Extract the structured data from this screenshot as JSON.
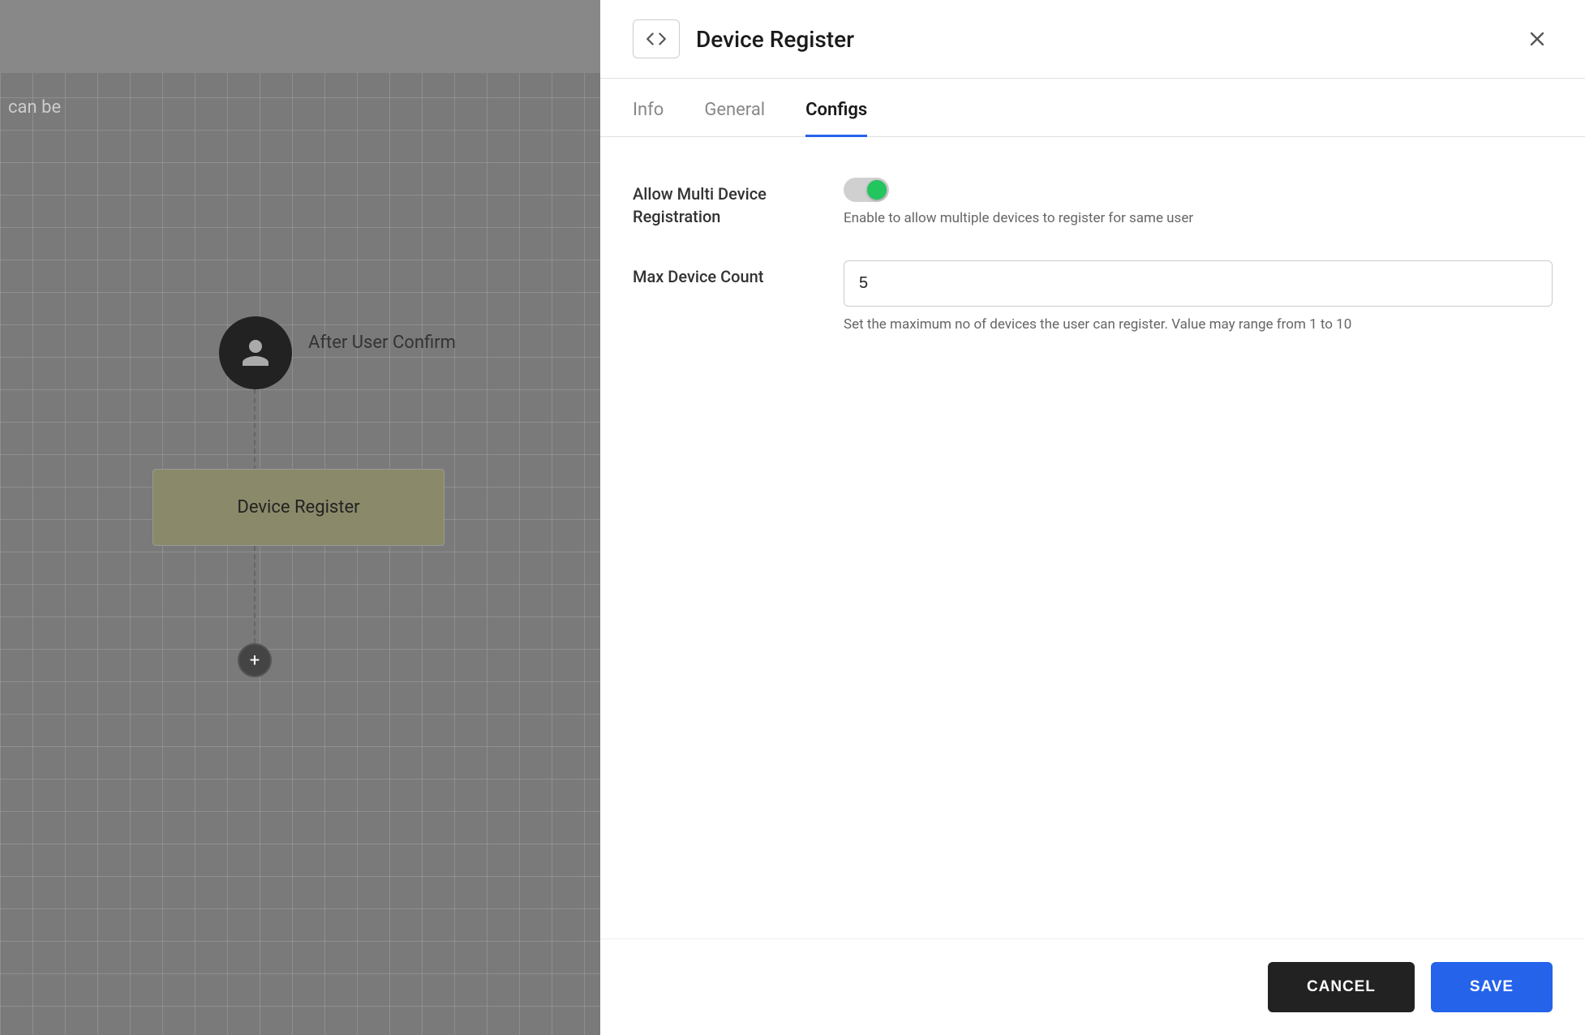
{
  "leftPanel": {
    "canBeText": "can be",
    "afterUserLabel": "After User Confirm",
    "deviceRegisterLabel": "Device Register",
    "plusSymbol": "+"
  },
  "rightPanel": {
    "header": {
      "codeIconLabel": "code-icon",
      "title": "Device Register",
      "closeIconLabel": "close-icon"
    },
    "tabs": [
      {
        "id": "info",
        "label": "Info"
      },
      {
        "id": "general",
        "label": "General"
      },
      {
        "id": "configs",
        "label": "Configs",
        "active": true
      }
    ],
    "configs": {
      "multiDeviceRegistration": {
        "label": "Allow Multi Device\nRegistration",
        "toggleOn": true,
        "hint": "Enable to allow multiple devices to register for same user"
      },
      "maxDeviceCount": {
        "label": "Max Device Count",
        "value": "5",
        "hint": "Set the maximum no of devices the user can register. Value may range from 1 to 10"
      }
    },
    "footer": {
      "cancelLabel": "CANCEL",
      "saveLabel": "SAVE"
    }
  }
}
